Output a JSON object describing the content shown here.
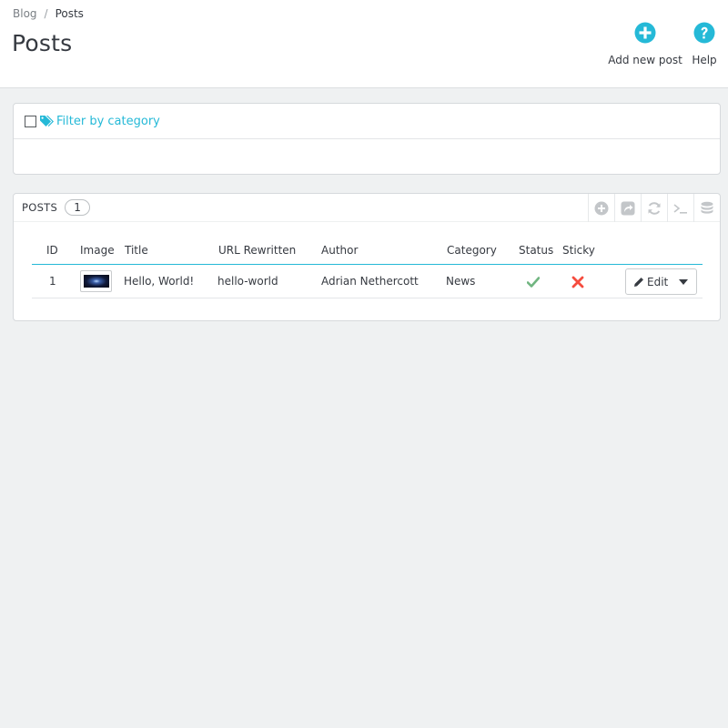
{
  "breadcrumb": {
    "parent": "Blog",
    "separator": "/",
    "current": "Posts"
  },
  "header": {
    "title": "Posts",
    "add_label": "Add new post",
    "help_label": "Help",
    "add_icon": "plus-circle-icon",
    "help_icon": "question-circle-icon"
  },
  "filter": {
    "label": "Filter by category",
    "checked": false,
    "icon": "tags-icon"
  },
  "list": {
    "title": "POSTS",
    "count": "1",
    "actions": [
      "add-circle-icon",
      "export-icon",
      "refresh-icon",
      "sql-terminal-icon",
      "database-icon"
    ],
    "columns": [
      "ID",
      "Image",
      "Title",
      "URL Rewritten",
      "Author",
      "Category",
      "Status",
      "Sticky"
    ],
    "rows": [
      {
        "id": "1",
        "title": "Hello, World!",
        "url_rewritten": "hello-world",
        "author": "Adrian Nethercott",
        "category": "News",
        "status": "enabled",
        "sticky": "disabled",
        "edit_label": "Edit"
      }
    ]
  },
  "colors": {
    "accent": "#25b9d7",
    "success": "#70b580",
    "danger": "#f54c3e",
    "text": "#363a41",
    "background": "#eff1f2"
  }
}
